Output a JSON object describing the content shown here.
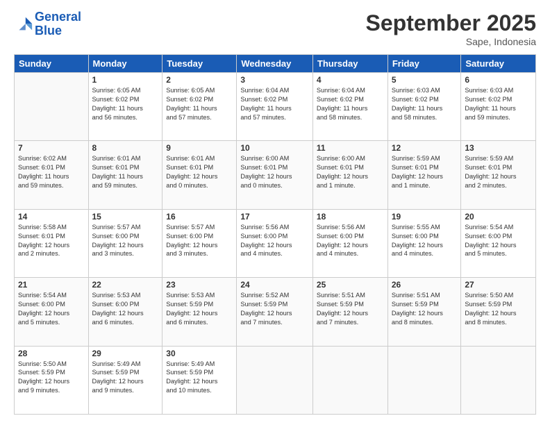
{
  "header": {
    "logo_line1": "General",
    "logo_line2": "Blue",
    "month": "September 2025",
    "location": "Sape, Indonesia"
  },
  "days_of_week": [
    "Sunday",
    "Monday",
    "Tuesday",
    "Wednesday",
    "Thursday",
    "Friday",
    "Saturday"
  ],
  "weeks": [
    [
      {
        "day": "",
        "info": ""
      },
      {
        "day": "1",
        "info": "Sunrise: 6:05 AM\nSunset: 6:02 PM\nDaylight: 11 hours\nand 56 minutes."
      },
      {
        "day": "2",
        "info": "Sunrise: 6:05 AM\nSunset: 6:02 PM\nDaylight: 11 hours\nand 57 minutes."
      },
      {
        "day": "3",
        "info": "Sunrise: 6:04 AM\nSunset: 6:02 PM\nDaylight: 11 hours\nand 57 minutes."
      },
      {
        "day": "4",
        "info": "Sunrise: 6:04 AM\nSunset: 6:02 PM\nDaylight: 11 hours\nand 58 minutes."
      },
      {
        "day": "5",
        "info": "Sunrise: 6:03 AM\nSunset: 6:02 PM\nDaylight: 11 hours\nand 58 minutes."
      },
      {
        "day": "6",
        "info": "Sunrise: 6:03 AM\nSunset: 6:02 PM\nDaylight: 11 hours\nand 59 minutes."
      }
    ],
    [
      {
        "day": "7",
        "info": "Sunrise: 6:02 AM\nSunset: 6:01 PM\nDaylight: 11 hours\nand 59 minutes."
      },
      {
        "day": "8",
        "info": "Sunrise: 6:01 AM\nSunset: 6:01 PM\nDaylight: 11 hours\nand 59 minutes."
      },
      {
        "day": "9",
        "info": "Sunrise: 6:01 AM\nSunset: 6:01 PM\nDaylight: 12 hours\nand 0 minutes."
      },
      {
        "day": "10",
        "info": "Sunrise: 6:00 AM\nSunset: 6:01 PM\nDaylight: 12 hours\nand 0 minutes."
      },
      {
        "day": "11",
        "info": "Sunrise: 6:00 AM\nSunset: 6:01 PM\nDaylight: 12 hours\nand 1 minute."
      },
      {
        "day": "12",
        "info": "Sunrise: 5:59 AM\nSunset: 6:01 PM\nDaylight: 12 hours\nand 1 minute."
      },
      {
        "day": "13",
        "info": "Sunrise: 5:59 AM\nSunset: 6:01 PM\nDaylight: 12 hours\nand 2 minutes."
      }
    ],
    [
      {
        "day": "14",
        "info": "Sunrise: 5:58 AM\nSunset: 6:01 PM\nDaylight: 12 hours\nand 2 minutes."
      },
      {
        "day": "15",
        "info": "Sunrise: 5:57 AM\nSunset: 6:00 PM\nDaylight: 12 hours\nand 3 minutes."
      },
      {
        "day": "16",
        "info": "Sunrise: 5:57 AM\nSunset: 6:00 PM\nDaylight: 12 hours\nand 3 minutes."
      },
      {
        "day": "17",
        "info": "Sunrise: 5:56 AM\nSunset: 6:00 PM\nDaylight: 12 hours\nand 4 minutes."
      },
      {
        "day": "18",
        "info": "Sunrise: 5:56 AM\nSunset: 6:00 PM\nDaylight: 12 hours\nand 4 minutes."
      },
      {
        "day": "19",
        "info": "Sunrise: 5:55 AM\nSunset: 6:00 PM\nDaylight: 12 hours\nand 4 minutes."
      },
      {
        "day": "20",
        "info": "Sunrise: 5:54 AM\nSunset: 6:00 PM\nDaylight: 12 hours\nand 5 minutes."
      }
    ],
    [
      {
        "day": "21",
        "info": "Sunrise: 5:54 AM\nSunset: 6:00 PM\nDaylight: 12 hours\nand 5 minutes."
      },
      {
        "day": "22",
        "info": "Sunrise: 5:53 AM\nSunset: 6:00 PM\nDaylight: 12 hours\nand 6 minutes."
      },
      {
        "day": "23",
        "info": "Sunrise: 5:53 AM\nSunset: 5:59 PM\nDaylight: 12 hours\nand 6 minutes."
      },
      {
        "day": "24",
        "info": "Sunrise: 5:52 AM\nSunset: 5:59 PM\nDaylight: 12 hours\nand 7 minutes."
      },
      {
        "day": "25",
        "info": "Sunrise: 5:51 AM\nSunset: 5:59 PM\nDaylight: 12 hours\nand 7 minutes."
      },
      {
        "day": "26",
        "info": "Sunrise: 5:51 AM\nSunset: 5:59 PM\nDaylight: 12 hours\nand 8 minutes."
      },
      {
        "day": "27",
        "info": "Sunrise: 5:50 AM\nSunset: 5:59 PM\nDaylight: 12 hours\nand 8 minutes."
      }
    ],
    [
      {
        "day": "28",
        "info": "Sunrise: 5:50 AM\nSunset: 5:59 PM\nDaylight: 12 hours\nand 9 minutes."
      },
      {
        "day": "29",
        "info": "Sunrise: 5:49 AM\nSunset: 5:59 PM\nDaylight: 12 hours\nand 9 minutes."
      },
      {
        "day": "30",
        "info": "Sunrise: 5:49 AM\nSunset: 5:59 PM\nDaylight: 12 hours\nand 10 minutes."
      },
      {
        "day": "",
        "info": ""
      },
      {
        "day": "",
        "info": ""
      },
      {
        "day": "",
        "info": ""
      },
      {
        "day": "",
        "info": ""
      }
    ]
  ]
}
